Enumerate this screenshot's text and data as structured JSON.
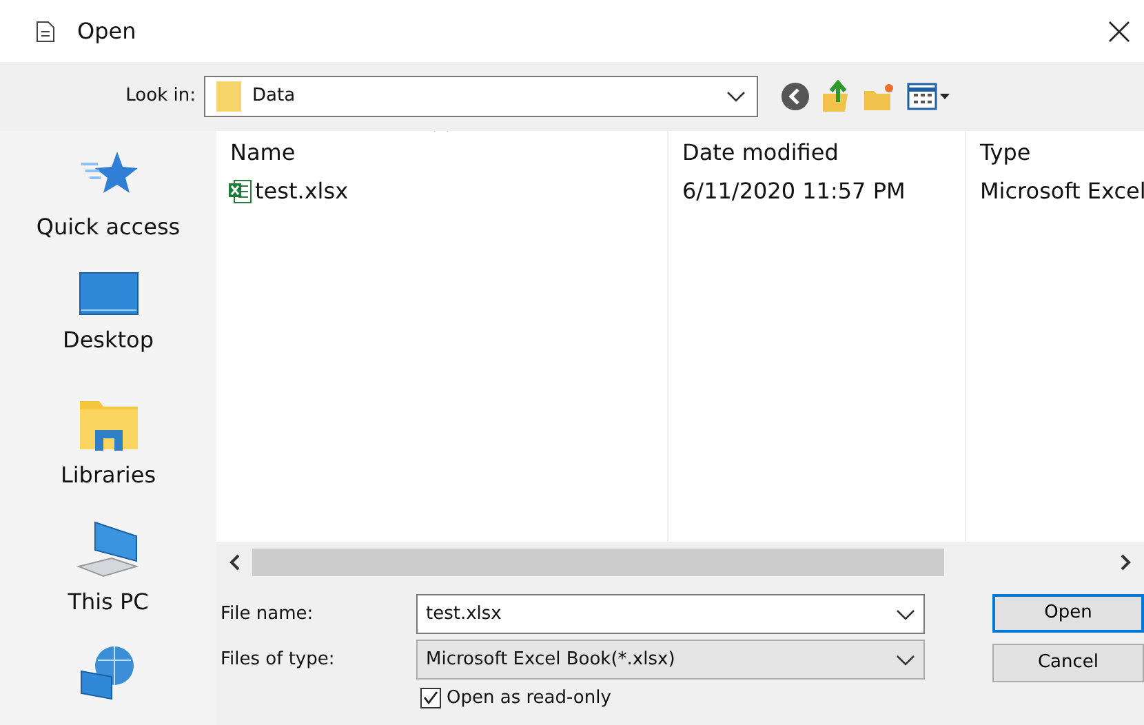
{
  "window": {
    "title": "Open"
  },
  "look_in": {
    "label": "Look in:",
    "value": "Data"
  },
  "sidebar": {
    "items": [
      {
        "label": "Quick access",
        "kind": "star"
      },
      {
        "label": "Desktop",
        "kind": "desktop"
      },
      {
        "label": "Libraries",
        "kind": "library"
      },
      {
        "label": "This PC",
        "kind": "pc"
      },
      {
        "kind": "network"
      }
    ]
  },
  "table": {
    "columns": [
      {
        "label": "Name",
        "sorted": true
      },
      {
        "label": "Date modified",
        "sorted": false
      },
      {
        "label": "Type",
        "sorted": false
      }
    ],
    "rows": [
      {
        "name": "test.xlsx",
        "date": "6/11/2020 11:57 PM",
        "type": "Microsoft Excel"
      }
    ]
  },
  "file_name": {
    "label": "File name:",
    "value": "test.xlsx"
  },
  "file_type": {
    "label": "Files of type:",
    "value": "Microsoft Excel Book(*.xlsx)"
  },
  "read_only": {
    "label": "Open as read-only",
    "checked": true
  },
  "buttons": [
    {
      "label": "Open",
      "default": true
    },
    {
      "label": "Cancel",
      "default": false
    }
  ]
}
